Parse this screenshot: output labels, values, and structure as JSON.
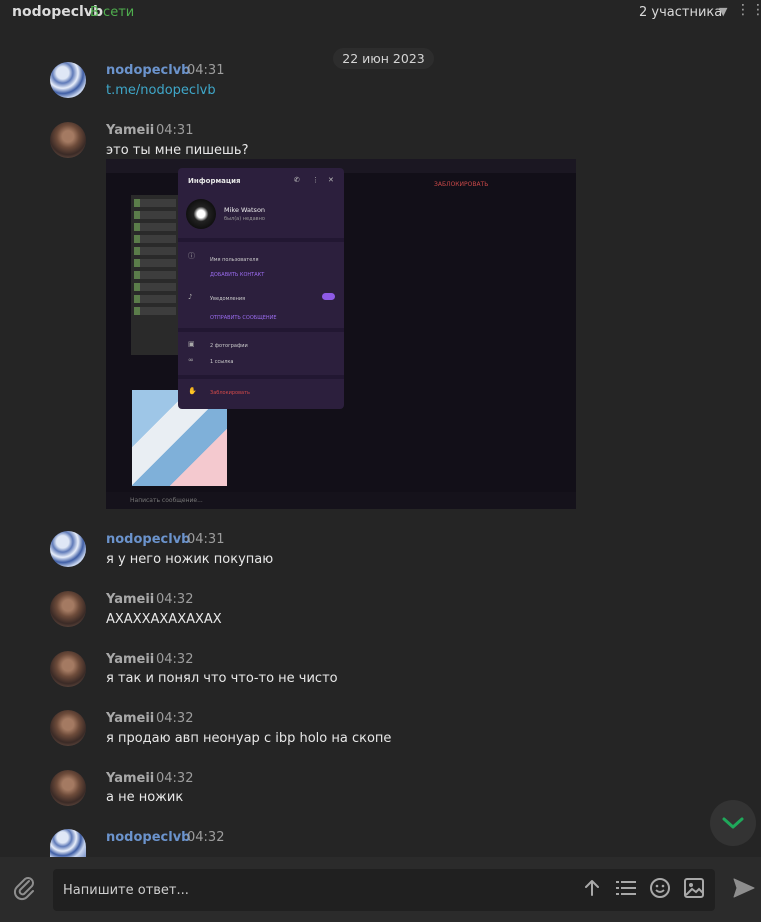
{
  "header": {
    "chat_name": "nodopeclvb",
    "status": "В сети",
    "participants": "2 участника",
    "chevron_icon": "chevron-down-icon",
    "more_icon": "more-icon"
  },
  "date_separator": "22 июн 2023",
  "messages": [
    {
      "author": "nodopeclvb",
      "time": "04:31",
      "text": "t.me/nodopeclvb"
    },
    {
      "author": "Yameii",
      "time": "04:31",
      "text": "это ты мне пишешь?"
    },
    {
      "author": "nodopeclvb",
      "time": "04:31",
      "text": "я у него ножик покупаю"
    },
    {
      "author": "Yameii",
      "time": "04:32",
      "text": "АХАХХАХАХАХАХ"
    },
    {
      "author": "Yameii",
      "time": "04:32",
      "text": "я так и понял что что-то не чисто"
    },
    {
      "author": "Yameii",
      "time": "04:32",
      "text": "я продаю авп неонуар с ibp holo на скопе"
    },
    {
      "author": "Yameii",
      "time": "04:32",
      "text": "а не ножик"
    },
    {
      "author": "nodopeclvb",
      "time": "04:32",
      "text": ""
    }
  ],
  "screenshot": {
    "panel_title": "Информация",
    "name": "Mike Watson",
    "last_seen": "был(а) недавно",
    "username_caption": "Имя пользователя",
    "add_contact": "ДОБАВИТЬ КОНТАКТ",
    "notifications": "Уведомления",
    "send_message": "ОТПРАВИТЬ СООБЩЕНИЕ",
    "photos": "2 фотографии",
    "links": "1 ссылка",
    "block": "Заблокировать",
    "blocked_header": "ЗАБЛОКИРОВАТЬ",
    "input_placeholder": "Написать сообщение..."
  },
  "composer": {
    "placeholder": "Напишите ответ...",
    "icons": [
      "attach-icon",
      "scroll-up-icon",
      "commands-icon",
      "emoji-icon",
      "media-icon",
      "send-icon"
    ]
  },
  "colors": {
    "background": "#252525",
    "online": "#4fae4e",
    "author_nodo": "#6b93cc",
    "link": "#3fa7c9",
    "accent_green": "#1fa85a"
  }
}
